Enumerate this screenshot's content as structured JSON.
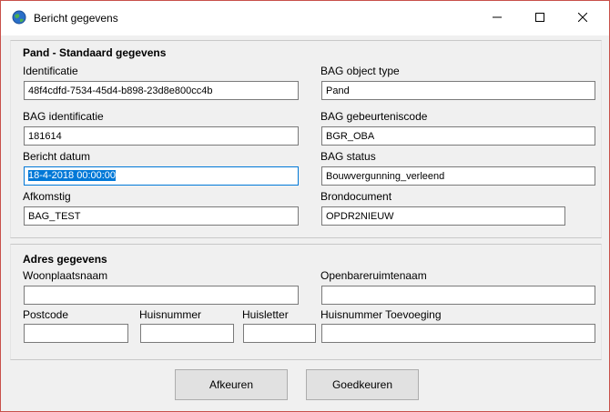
{
  "window": {
    "title": "Bericht gegevens",
    "icons": {
      "app": "globe-icon",
      "minimize": "minimize-icon",
      "maximize": "maximize-icon",
      "close": "close-icon"
    }
  },
  "pand": {
    "section_title": "Pand - Standaard gegevens",
    "identificatie": {
      "label": "Identificatie",
      "value": "48f4cdfd-7534-45d4-b898-23d8e800cc4b"
    },
    "bag_object_type": {
      "label": "BAG object type",
      "value": "Pand"
    },
    "bag_identificatie": {
      "label": "BAG identificatie",
      "value": "181614"
    },
    "bag_gebeurteniscode": {
      "label": "BAG gebeurteniscode",
      "value": "BGR_OBA"
    },
    "bericht_datum": {
      "label": "Bericht datum",
      "value": "18-4-2018 00:00:00"
    },
    "bag_status": {
      "label": "BAG status",
      "value": "Bouwvergunning_verleend"
    },
    "afkomstig": {
      "label": "Afkomstig",
      "value": "BAG_TEST"
    },
    "brondocument": {
      "label": "Brondocument",
      "value": "OPDR2NIEUW"
    }
  },
  "adres": {
    "section_title": "Adres gegevens",
    "woonplaatsnaam": {
      "label": "Woonplaatsnaam",
      "value": ""
    },
    "openbareruimtenaam": {
      "label": "Openbareruimtenaam",
      "value": ""
    },
    "postcode": {
      "label": "Postcode",
      "value": ""
    },
    "huisnummer": {
      "label": "Huisnummer",
      "value": ""
    },
    "huisletter": {
      "label": "Huisletter",
      "value": ""
    },
    "huisnummer_toevoeging": {
      "label": "Huisnummer Toevoeging",
      "value": ""
    }
  },
  "buttons": {
    "afkeuren": "Afkeuren",
    "goedkeuren": "Goedkeuren"
  },
  "colors": {
    "focus": "#0078d7",
    "window_border": "#c8504a"
  }
}
